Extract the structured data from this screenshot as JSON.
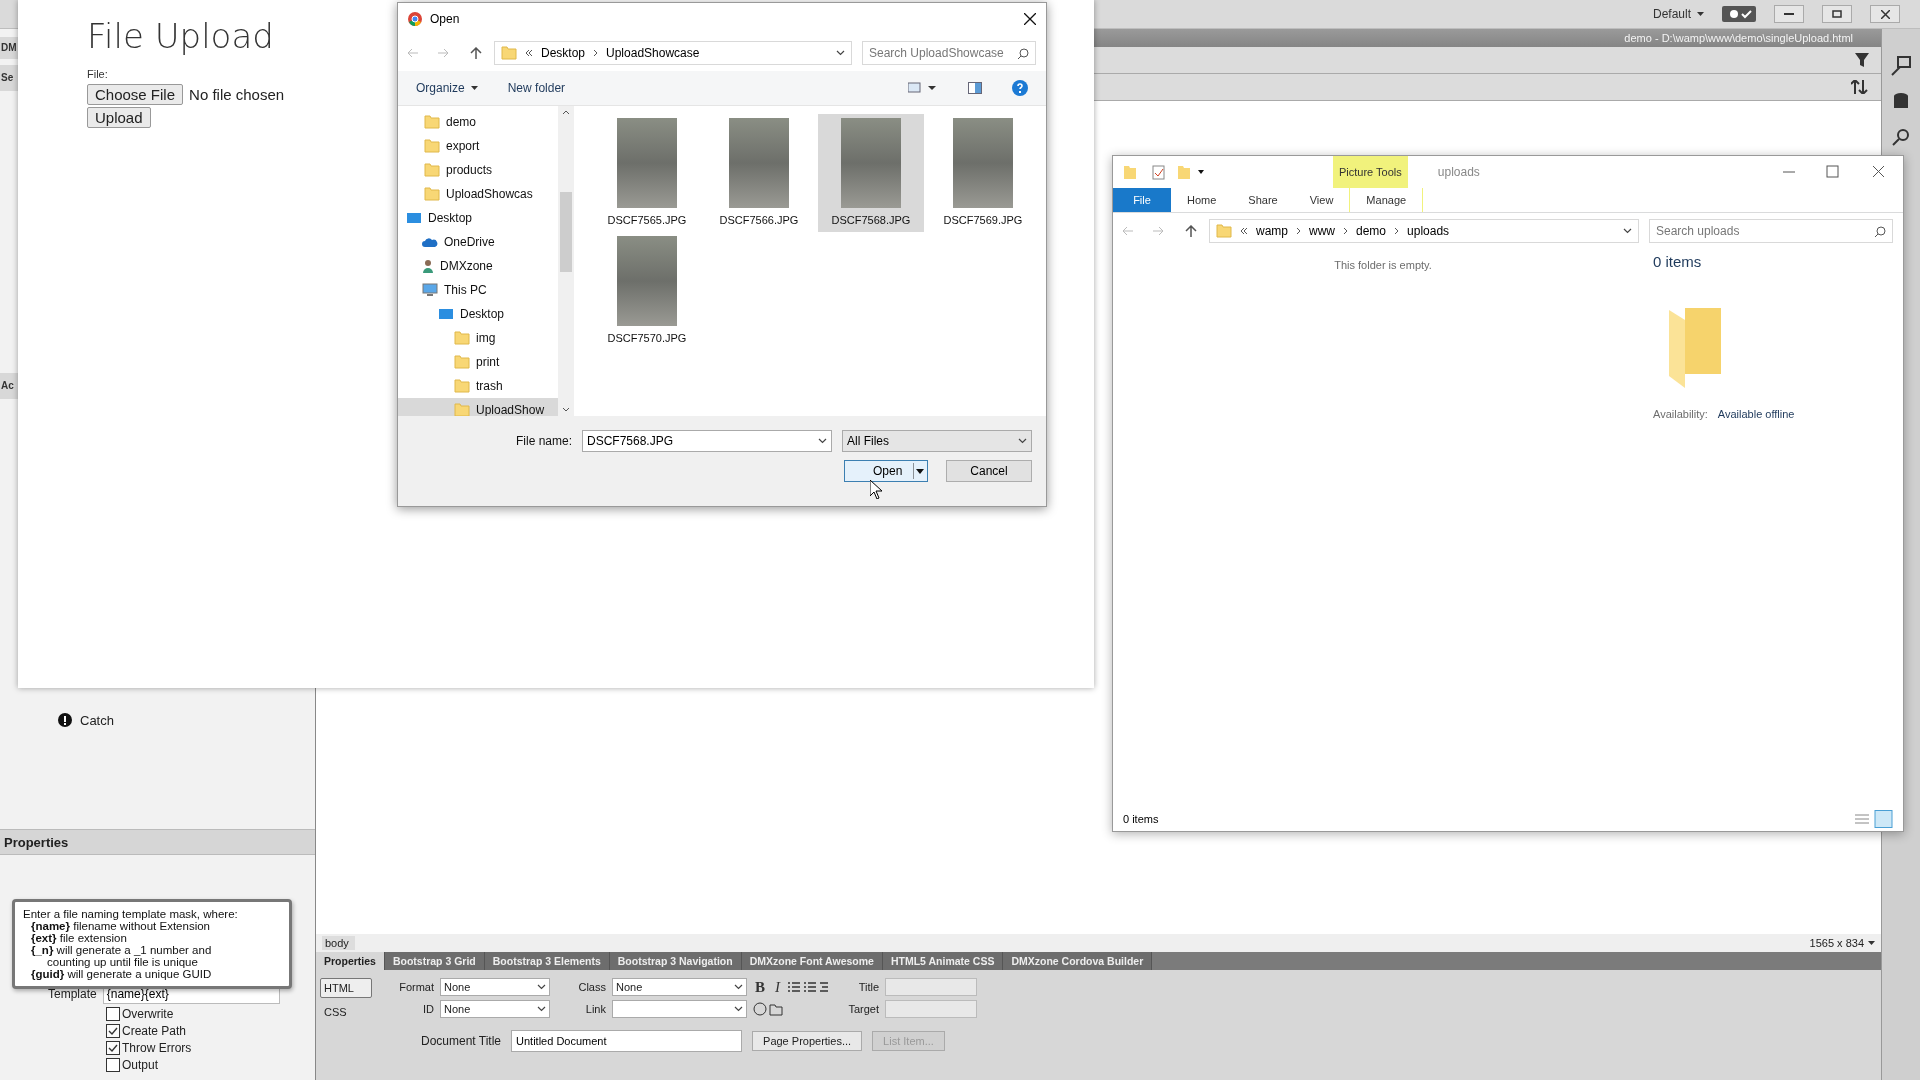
{
  "editor": {
    "workspace": "Default",
    "document_path": "demo - D:\\wamp\\www\\demo\\singleUpload.html",
    "panel_fragments": [
      "DM",
      "Se",
      "Ac"
    ],
    "behaviors": [
      {
        "label": "Catch",
        "selected": false
      }
    ],
    "properties_panel": {
      "title": "Properties",
      "tooltip": [
        "Enter a file naming template mask, where:",
        "**{name}** filename without Extension",
        "**{ext}** file extension",
        "**{_n}** will generate a _1 number and",
        "counting up until file is unique",
        "**{guid}** will generate a unique GUID"
      ],
      "template_label": "Template",
      "template_value": "{name}{ext}",
      "options": [
        {
          "label": "Overwrite",
          "checked": false
        },
        {
          "label": "Create Path",
          "checked": true
        },
        {
          "label": "Throw Errors",
          "checked": true
        },
        {
          "label": "Output",
          "checked": false
        }
      ]
    },
    "tag_selector": "body",
    "screen_size": "1565 x 834",
    "panel_tabs": [
      {
        "label": "Properties",
        "selected": true
      },
      {
        "label": "Bootstrap 3 Grid",
        "selected": false
      },
      {
        "label": "Bootstrap 3 Elements",
        "selected": false
      },
      {
        "label": "Bootstrap 3 Navigation",
        "selected": false
      },
      {
        "label": "DMXzone Font Awesome",
        "selected": false
      },
      {
        "label": "HTML5 Animate CSS",
        "selected": false
      },
      {
        "label": "DMXzone Cordova Builder",
        "selected": false
      }
    ],
    "inspector": {
      "text_styles": [
        "B",
        "I"
      ],
      "modes": [
        {
          "label": "HTML",
          "selected": true
        },
        {
          "label": "CSS",
          "selected": false
        }
      ],
      "format_label": "Format",
      "format": "None",
      "id_label": "ID",
      "id": "None",
      "class_label": "Class",
      "class": "None",
      "link_label": "Link",
      "title_label": "Title",
      "target_label": "Target",
      "doc_title_label": "Document Title",
      "doc_title": "Untitled Document",
      "buttons": [
        {
          "label": "Page Properties...",
          "disabled": false
        },
        {
          "label": "List Item...",
          "disabled": true
        }
      ]
    }
  },
  "browser": {
    "heading": "File Upload",
    "field_label": "File:",
    "choose_button": "Choose File",
    "file_status": "No file chosen",
    "upload_button": "Upload"
  },
  "open_dialog": {
    "title": "Open",
    "breadcrumb": [
      "Desktop",
      "UploadShowcase"
    ],
    "search_placeholder": "Search UploadShowcase",
    "organize": "Organize",
    "new_folder": "New folder",
    "nav": [
      {
        "label": "demo",
        "kind": "folder",
        "selected": false
      },
      {
        "label": "export",
        "kind": "folder",
        "selected": false
      },
      {
        "label": "products",
        "kind": "folder",
        "selected": false
      },
      {
        "label": "UploadShowcas",
        "kind": "folder",
        "selected": false
      },
      {
        "label": "Desktop",
        "kind": "desktop",
        "selected": false,
        "children": [
          {
            "label": "OneDrive",
            "kind": "cloud",
            "selected": false
          },
          {
            "label": "DMXzone",
            "kind": "user",
            "selected": false
          },
          {
            "label": "This PC",
            "kind": "pc",
            "selected": false,
            "children": [
              {
                "label": "Desktop",
                "kind": "desktop",
                "selected": false,
                "children": [
                  {
                    "label": "img",
                    "kind": "folder",
                    "selected": false
                  },
                  {
                    "label": "print",
                    "kind": "folder",
                    "selected": false
                  },
                  {
                    "label": "trash",
                    "kind": "folder",
                    "selected": false
                  },
                  {
                    "label": "UploadShow",
                    "kind": "folder",
                    "selected": true
                  }
                ]
              }
            ]
          }
        ]
      }
    ],
    "files": [
      {
        "name": "DSCF7565.JPG",
        "selected": false
      },
      {
        "name": "DSCF7566.JPG",
        "selected": false
      },
      {
        "name": "DSCF7568.JPG",
        "selected": true
      },
      {
        "name": "DSCF7569.JPG",
        "selected": false
      },
      {
        "name": "DSCF7570.JPG",
        "selected": false
      }
    ],
    "file_name_label": "File name:",
    "file_name": "DSCF7568.JPG",
    "file_type": "All Files",
    "open_button": "Open",
    "cancel_button": "Cancel"
  },
  "explorer": {
    "context_tab": "Picture Tools",
    "title": "uploads",
    "ribbon_tabs": [
      {
        "label": "File",
        "kind": "file"
      },
      {
        "label": "Home",
        "kind": "plain"
      },
      {
        "label": "Share",
        "kind": "plain"
      },
      {
        "label": "View",
        "kind": "plain"
      },
      {
        "label": "Manage",
        "kind": "context"
      }
    ],
    "breadcrumb": [
      "wamp",
      "www",
      "demo",
      "uploads"
    ],
    "search_placeholder": "Search uploads",
    "empty_message": "This folder is empty.",
    "details_count": "0 items",
    "availability_label": "Availability:",
    "availability_value": "Available offline",
    "status": "0 items"
  }
}
